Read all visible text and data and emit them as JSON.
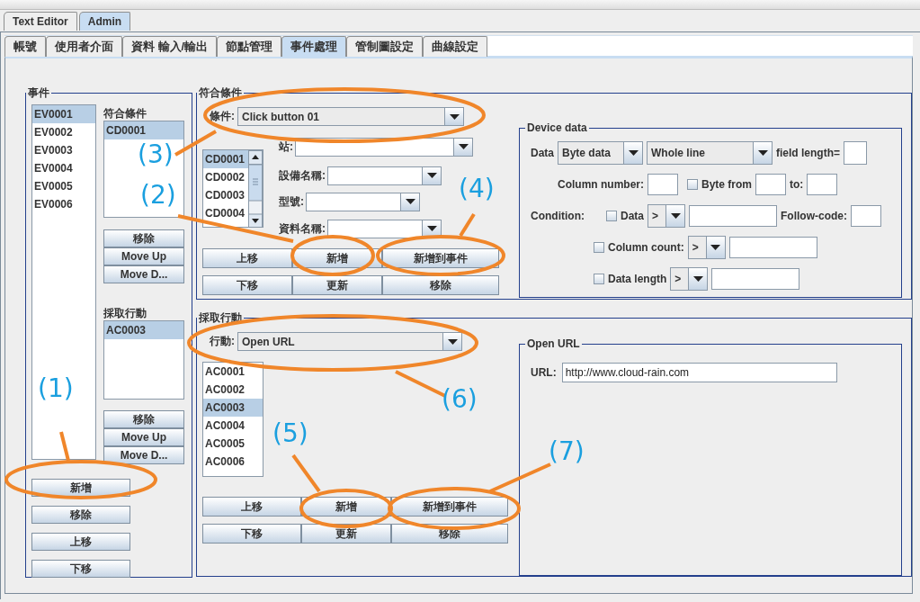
{
  "outer_tabs": [
    {
      "label": "Text Editor",
      "selected": false
    },
    {
      "label": "Admin",
      "selected": true
    }
  ],
  "tabs": [
    {
      "label": "帳號",
      "selected": false
    },
    {
      "label": "使用者介面",
      "selected": false
    },
    {
      "label": "資料  輸入/輸出",
      "selected": false
    },
    {
      "label": "節點管理",
      "selected": false
    },
    {
      "label": "事件處理",
      "selected": true
    },
    {
      "label": "管制圖設定",
      "selected": false
    },
    {
      "label": "曲線設定",
      "selected": false
    }
  ],
  "events_panel": {
    "title": "事件",
    "items": [
      {
        "label": "EV0001",
        "selected": true
      },
      {
        "label": "EV0002",
        "selected": false
      },
      {
        "label": "EV0003",
        "selected": false
      },
      {
        "label": "EV0004",
        "selected": false
      },
      {
        "label": "EV0005",
        "selected": false
      },
      {
        "label": "EV0006",
        "selected": false
      }
    ],
    "conditions_label": "符合條件",
    "conditions": [
      {
        "label": "CD0001",
        "selected": true
      }
    ],
    "condition_buttons": [
      "移除",
      "Move Up",
      "Move D..."
    ],
    "actions_label": "採取行動",
    "actions": [
      {
        "label": "AC0003",
        "selected": true
      }
    ],
    "action_buttons": [
      "移除",
      "Move Up",
      "Move D..."
    ],
    "buttons": [
      "新增",
      "移除",
      "上移",
      "下移"
    ]
  },
  "condition_panel": {
    "title": "符合條件",
    "condition": {
      "label": "條件:",
      "value": "Click button 01"
    },
    "list": [
      {
        "label": "CD0001",
        "selected": true
      },
      {
        "label": "CD0002",
        "selected": false
      },
      {
        "label": "CD0003",
        "selected": false
      },
      {
        "label": "CD0004",
        "selected": false
      }
    ],
    "fields": [
      {
        "label": "站:"
      },
      {
        "label": "設備名稱:"
      },
      {
        "label": "型號:"
      },
      {
        "label": "資料名稱:"
      }
    ],
    "buttons": [
      [
        "上移",
        "新增",
        "新增到事件"
      ],
      [
        "下移",
        "更新",
        "移除"
      ]
    ],
    "device_data": {
      "title": "Device data",
      "data_label": "Data",
      "data_type": "Byte data",
      "data_scope": "Whole line",
      "field_length_label": "field length=",
      "column_number_label": "Column number:",
      "byte_from": {
        "label": "Byte from",
        "checked": false
      },
      "to_label": "to:",
      "condition_label": "Condition:",
      "follow_code_label": "Follow-code:",
      "conditions": [
        {
          "label": "Data",
          "checked": false,
          "operator": ">"
        },
        {
          "label": "Column count:",
          "checked": false,
          "operator": ">"
        },
        {
          "label": "Data length",
          "checked": false,
          "operator": ">"
        }
      ]
    }
  },
  "action_panel": {
    "title": "採取行動",
    "action": {
      "label": "行動:",
      "value": "Open URL"
    },
    "list": [
      {
        "label": "AC0001",
        "selected": false
      },
      {
        "label": "AC0002",
        "selected": false
      },
      {
        "label": "AC0003",
        "selected": true
      },
      {
        "label": "AC0004",
        "selected": false
      },
      {
        "label": "AC0005",
        "selected": false
      },
      {
        "label": "AC0006",
        "selected": false
      }
    ],
    "buttons": [
      [
        "上移",
        "新增",
        "新增到事件"
      ],
      [
        "下移",
        "更新",
        "移除"
      ]
    ],
    "detail": {
      "title": "Open URL",
      "url_label": "URL:",
      "url": "http://www.cloud-rain.com"
    }
  },
  "annotations": [
    {
      "label": "(1)"
    },
    {
      "label": "(2)"
    },
    {
      "label": "(3)"
    },
    {
      "label": "(4)"
    },
    {
      "label": "(5)"
    },
    {
      "label": "(6)"
    },
    {
      "label": "(7)"
    }
  ]
}
